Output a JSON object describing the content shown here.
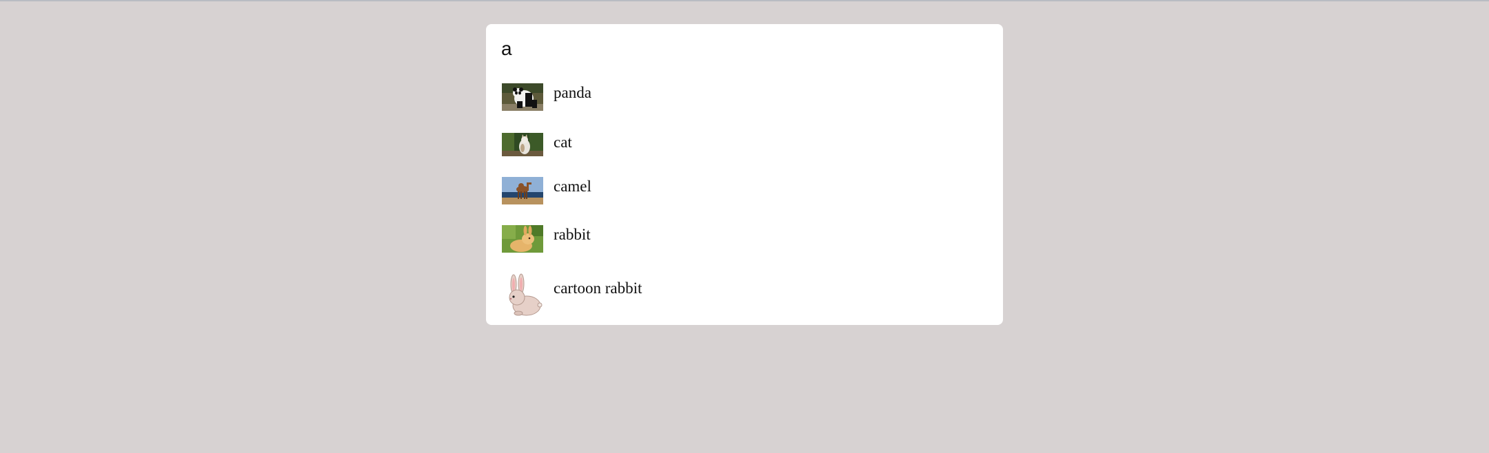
{
  "search": {
    "query": "a"
  },
  "results": [
    {
      "label": "panda",
      "icon": "panda-photo"
    },
    {
      "label": "cat",
      "icon": "cat-photo"
    },
    {
      "label": "camel",
      "icon": "camel-photo"
    },
    {
      "label": "rabbit",
      "icon": "rabbit-photo"
    },
    {
      "label": "cartoon rabbit",
      "icon": "cartoon-rabbit-icon"
    }
  ],
  "colors": {
    "page_background": "#d7d2d2",
    "card_background": "#ffffff"
  }
}
